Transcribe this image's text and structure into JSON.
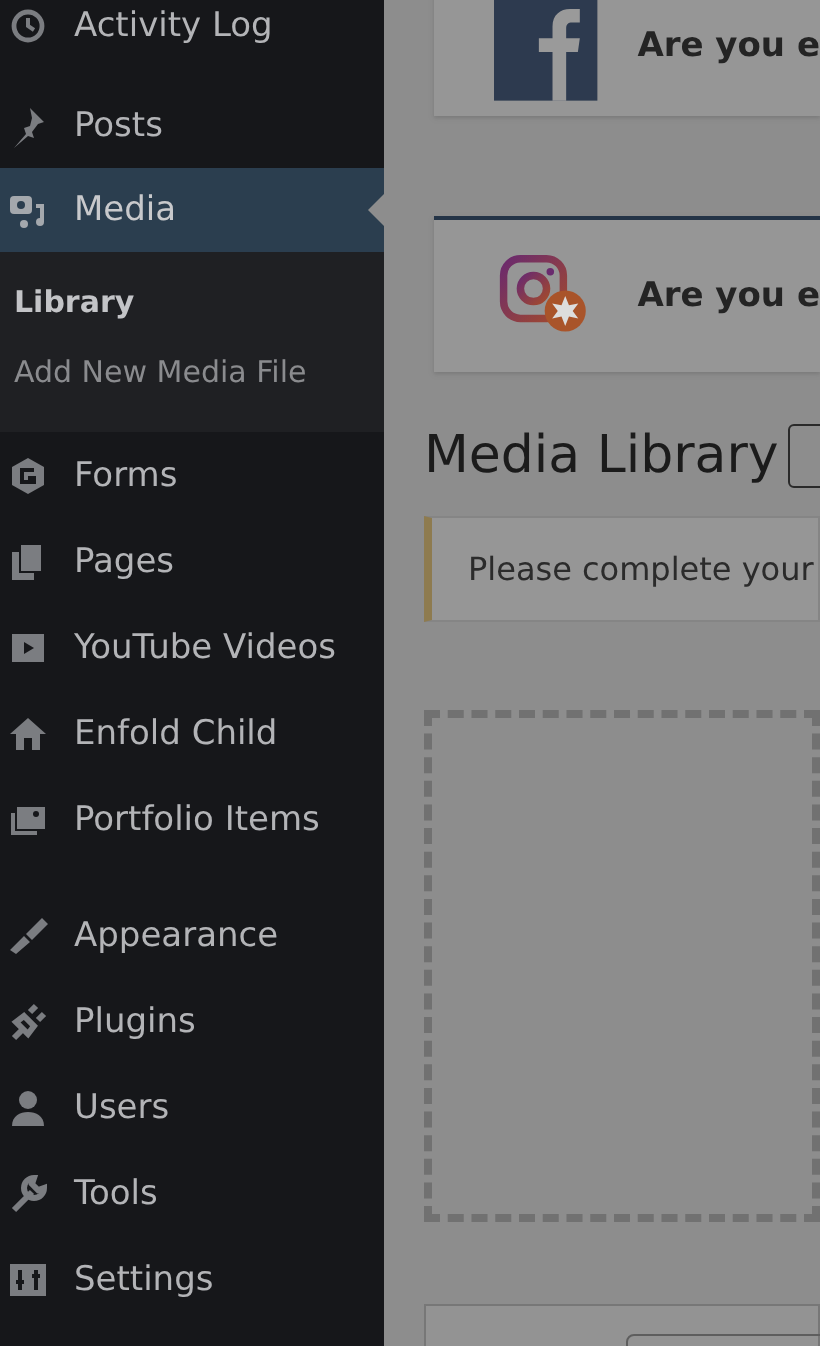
{
  "sidebar": {
    "groups": [
      {
        "items": [
          {
            "label": "Activity Log",
            "selected": false
          }
        ]
      },
      {
        "items": [
          {
            "label": "Posts",
            "selected": false
          },
          {
            "label": "Media",
            "selected": true,
            "children": [
              {
                "label": "Library",
                "selected": true
              },
              {
                "label": "Add New Media File",
                "selected": false
              }
            ]
          },
          {
            "label": "Forms",
            "selected": false
          },
          {
            "label": "Pages",
            "selected": false
          },
          {
            "label": "YouTube Videos",
            "selected": false
          },
          {
            "label": "Enfold Child",
            "selected": false
          },
          {
            "label": "Portfolio Items",
            "selected": false
          }
        ]
      },
      {
        "items": [
          {
            "label": "Appearance",
            "selected": false
          },
          {
            "label": "Plugins",
            "selected": false
          },
          {
            "label": "Users",
            "selected": false
          },
          {
            "label": "Tools",
            "selected": false
          },
          {
            "label": "Settings",
            "selected": false
          }
        ]
      }
    ]
  },
  "notices": [
    {
      "text": "Are you e"
    },
    {
      "text": "Are you e"
    }
  ],
  "page": {
    "title": "Media Library",
    "alert": "Please complete your"
  }
}
